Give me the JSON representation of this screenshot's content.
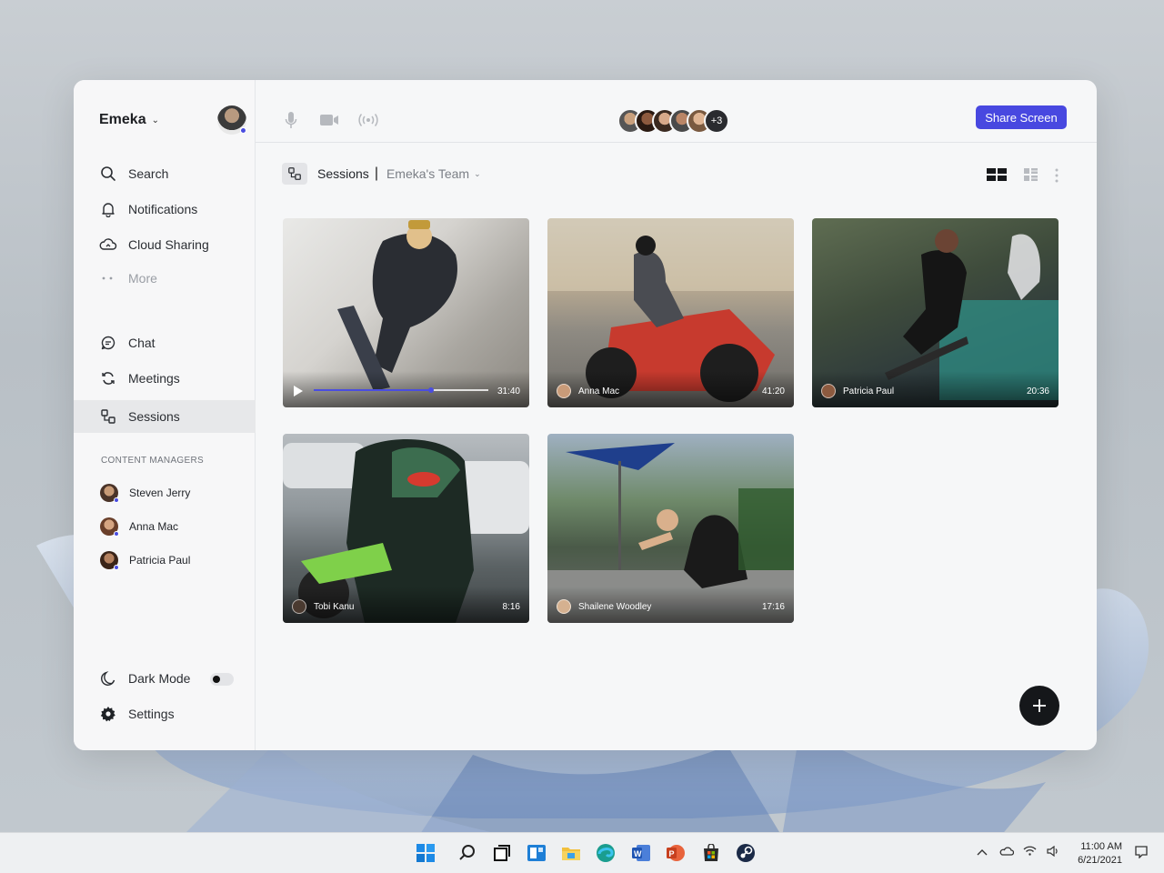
{
  "sidebar": {
    "user_name": "Emeka",
    "nav_primary": [
      {
        "label": "Search",
        "icon": "search-icon"
      },
      {
        "label": "Notifications",
        "icon": "bell-icon"
      },
      {
        "label": "Cloud Sharing",
        "icon": "cloud-sharing-icon"
      },
      {
        "label": "More",
        "icon": "more-dots-icon"
      }
    ],
    "nav_secondary": [
      {
        "label": "Chat",
        "icon": "chat-icon"
      },
      {
        "label": "Meetings",
        "icon": "meetings-icon"
      },
      {
        "label": "Sessions",
        "icon": "sessions-icon",
        "active": true
      }
    ],
    "section_title": "CONTENT MANAGERS",
    "managers": [
      {
        "name": "Steven Jerry"
      },
      {
        "name": "Anna Mac"
      },
      {
        "name": "Patricia Paul"
      }
    ],
    "dark_mode_label": "Dark Mode",
    "dark_mode_on": false,
    "settings_label": "Settings"
  },
  "topbar": {
    "participants_extra": "+3",
    "share_button": "Share Screen"
  },
  "breadcrumb": {
    "current": "Sessions",
    "team": "Emeka's Team"
  },
  "sessions": [
    {
      "name": "",
      "duration": "31:40",
      "playing": true,
      "progress": 0.67
    },
    {
      "name": "Anna Mac",
      "duration": "41:20"
    },
    {
      "name": "Patricia Paul",
      "duration": "20:36"
    },
    {
      "name": "Tobi Kanu",
      "duration": "8:16"
    },
    {
      "name": "Shailene Woodley",
      "duration": "17:16"
    }
  ],
  "taskbar": {
    "time": "11:00 AM",
    "date": "6/21/2021"
  },
  "colors": {
    "accent": "#4848e0",
    "fab": "#15171a"
  }
}
